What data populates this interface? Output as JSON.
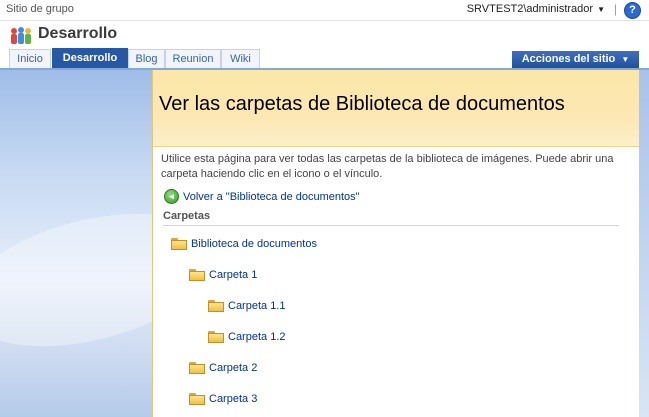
{
  "topbar": {
    "site_name": "Sitio de grupo",
    "user": "SRVTEST2\\administrador",
    "separator": "|",
    "help_glyph": "?"
  },
  "header": {
    "site_title": "Desarrollo",
    "logo_icon": "people-icon"
  },
  "tabs": [
    {
      "label": "Inicio",
      "active": false
    },
    {
      "label": "Desarrollo",
      "active": true
    },
    {
      "label": "Blog",
      "active": false
    },
    {
      "label": "Reunion",
      "active": false
    },
    {
      "label": "Wiki",
      "active": false
    }
  ],
  "site_actions": "Acciones del sitio",
  "page": {
    "title": "Ver las carpetas de Biblioteca de documentos",
    "description": "Utilice esta página para ver todas las carpetas de la biblioteca de imágenes. Puede abrir una carpeta haciendo clic en el icono o el vínculo.",
    "back_label": "Volver a \"Biblioteca de documentos\"",
    "section_heading": "Carpetas"
  },
  "folders": [
    {
      "label": "Biblioteca de documentos",
      "level": 0
    },
    {
      "label": "Carpeta 1",
      "level": 1
    },
    {
      "label": "Carpeta 1.1",
      "level": 2
    },
    {
      "label": "Carpeta 1.2",
      "level": 2
    },
    {
      "label": "Carpeta 2",
      "level": 1
    },
    {
      "label": "Carpeta 3",
      "level": 1
    }
  ],
  "colors": {
    "tab_active": "#2758a4",
    "link": "#003399",
    "header_band": "#fde7b2"
  }
}
